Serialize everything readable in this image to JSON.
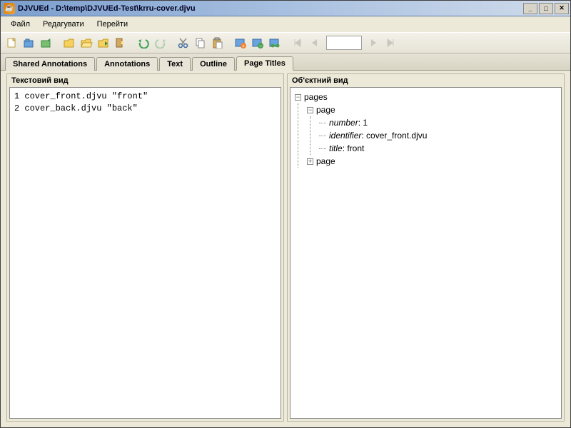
{
  "window": {
    "title": "DJVUEd - D:\\temp\\DJVUEd-Test\\krru-cover.djvu"
  },
  "menu": {
    "file": "Файл",
    "edit": "Редагувати",
    "goto": "Перейти"
  },
  "tabs": {
    "shared_annotations": "Shared Annotations",
    "annotations": "Annotations",
    "text": "Text",
    "outline": "Outline",
    "page_titles": "Page Titles"
  },
  "panes": {
    "text_view": "Текстовий вид",
    "object_view": "Об'єктний вид"
  },
  "text_lines": {
    "l1": "1 cover_front.djvu \"front\"",
    "l2": "2 cover_back.djvu \"back\""
  },
  "tree": {
    "root": "pages",
    "page1": "page",
    "kv_number_key": "number",
    "kv_number_val": " : 1",
    "kv_identifier_key": "identifier",
    "kv_identifier_val": " : cover_front.djvu",
    "kv_title_key": "title",
    "kv_title_val": " : front",
    "page2": "page"
  }
}
